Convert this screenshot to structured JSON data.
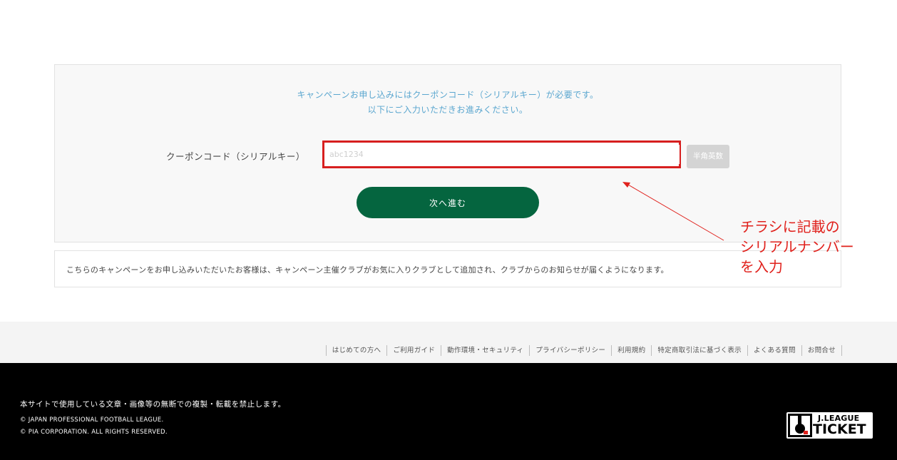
{
  "coupon": {
    "intro_line1": "キャンペーンお申し込みにはクーポンコード（シリアルキー）が必要です。",
    "intro_line2": "以下にご入力いただきお進みください。",
    "field_label": "クーポンコード（シリアルキー）",
    "input_placeholder": "abc1234",
    "input_value": "",
    "input_hint": "半角英数",
    "next_button": "次へ進む"
  },
  "notice": {
    "text": "こちらのキャンペーンをお申し込みいただいたお客様は、キャンペーン主催クラブがお気に入りクラブとして追加され、クラブからのお知らせが届くようになります。"
  },
  "annotation": {
    "lines": [
      "チラシに記載の",
      "シリアルナンバー",
      "を入力"
    ],
    "color": "#e0211c"
  },
  "footer": {
    "links": [
      "はじめての方へ",
      "ご利用ガイド",
      "動作環境・セキュリティ",
      "プライバシーポリシー",
      "利用規約",
      "特定商取引法に基づく表示",
      "よくある質問",
      "お問合せ"
    ],
    "notice": "本サイトで使用している文章・画像等の無断での複製・転載を禁止します。",
    "copyright1": "© JAPAN PROFESSIONAL FOOTBALL LEAGUE.",
    "copyright2": "© PIA CORPORATION. ALL RIGHTS RESERVED.",
    "logo_line1": "J.LEAGUE",
    "logo_line2": "TICKET"
  },
  "colors": {
    "primary_button": "#05653f",
    "intro_text": "#5aa6cf",
    "highlight_frame": "#d71f1f"
  }
}
